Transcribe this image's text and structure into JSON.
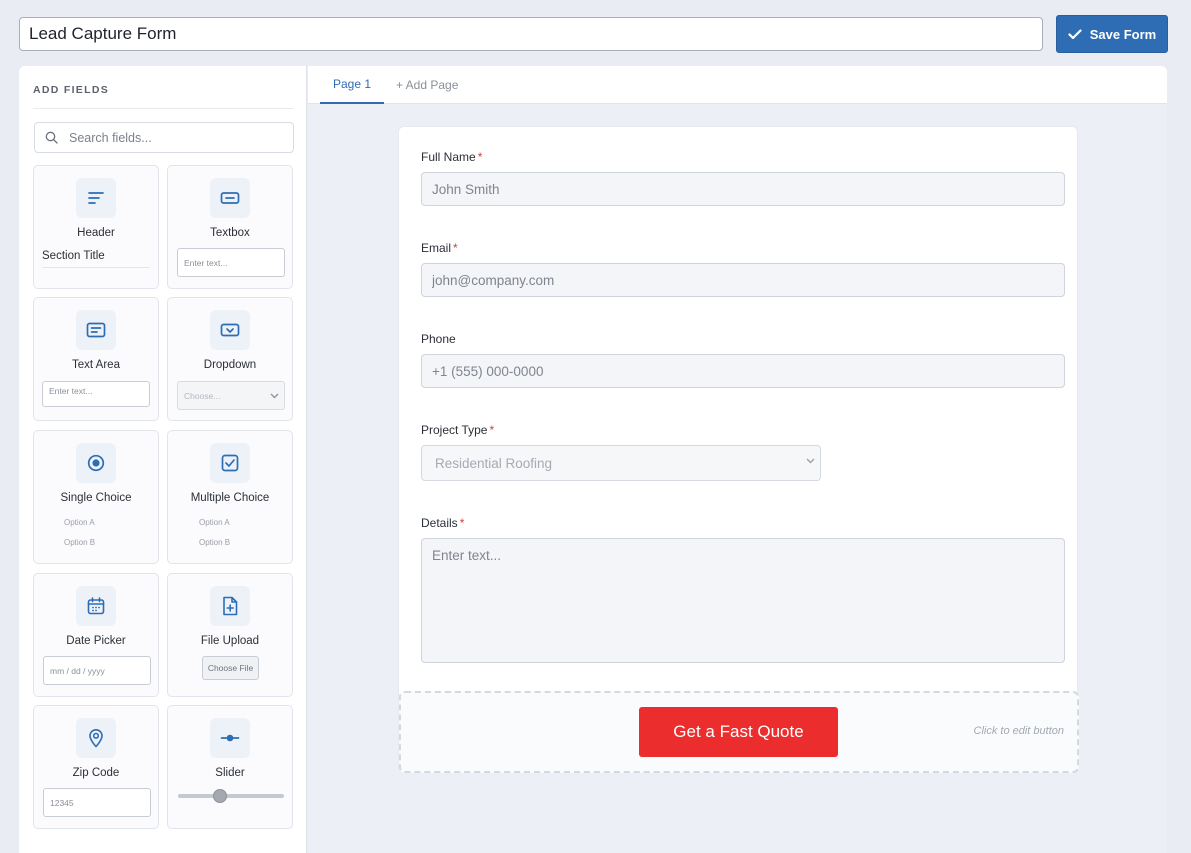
{
  "form": {
    "title": "Lead Capture Form"
  },
  "toolbar": {
    "save_label": "Save Form"
  },
  "sidebar": {
    "heading": "ADD FIELDS",
    "search_placeholder": "Search fields...",
    "tiles": {
      "header": {
        "label": "Header",
        "preview": "Section Title"
      },
      "textbox": {
        "label": "Textbox",
        "preview": "Enter text..."
      },
      "textarea": {
        "label": "Text Area",
        "preview": "Enter text..."
      },
      "dropdown": {
        "label": "Dropdown",
        "preview": "Choose..."
      },
      "single": {
        "label": "Single Choice",
        "options": [
          "Option A",
          "Option B"
        ]
      },
      "multiple": {
        "label": "Multiple Choice",
        "options": [
          "Option A",
          "Option B"
        ]
      },
      "date": {
        "label": "Date Picker",
        "preview": "mm / dd / yyyy"
      },
      "file": {
        "label": "File Upload",
        "preview": "Choose File"
      },
      "zip": {
        "label": "Zip Code",
        "preview": "12345"
      },
      "slider": {
        "label": "Slider",
        "value": 0.4
      }
    }
  },
  "tabs": {
    "page1": "Page 1",
    "add": "+ Add Page"
  },
  "fields": {
    "full_name": {
      "label": "Full Name",
      "required": "*",
      "placeholder": "John Smith"
    },
    "email": {
      "label": "Email",
      "required": "*",
      "placeholder": "john@company.com"
    },
    "phone": {
      "label": "Phone",
      "placeholder": "+1 (555) 000-0000"
    },
    "project_type": {
      "label": "Project Type",
      "required": "*",
      "value": "Residential Roofing"
    },
    "details": {
      "label": "Details",
      "required": "*",
      "placeholder": "Enter text..."
    }
  },
  "submit": {
    "label": "Get a Fast Quote",
    "hint": "Click to edit button"
  },
  "colors": {
    "primary": "#2e6db4",
    "cta": "#ec2d2d",
    "required": "#d63b3b"
  }
}
